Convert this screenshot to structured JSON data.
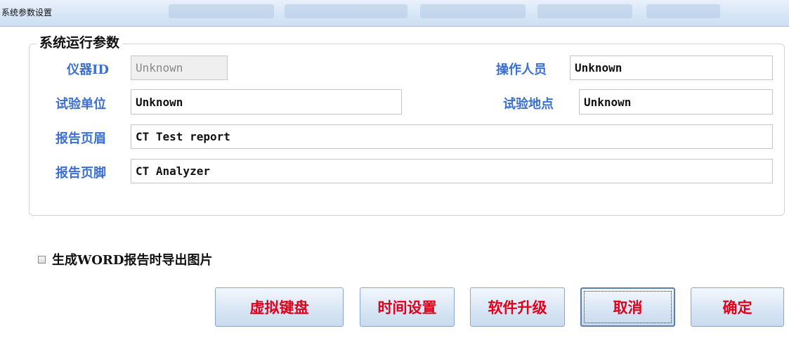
{
  "window": {
    "title": "系统参数设置"
  },
  "group": {
    "legend": "系统运行参数"
  },
  "fields": {
    "instrument_id": {
      "label": "仪器ID",
      "value": "Unknown"
    },
    "operator": {
      "label": "操作人员",
      "value": "Unknown"
    },
    "test_unit": {
      "label": "试验单位",
      "value": "Unknown"
    },
    "test_location": {
      "label": "试验地点",
      "value": "Unknown"
    },
    "report_header": {
      "label": "报告页眉",
      "value": "CT Test report"
    },
    "report_footer": {
      "label": "报告页脚",
      "value": "CT Analyzer"
    }
  },
  "export_images": {
    "label": "生成WORD报告时导出图片",
    "checked": false
  },
  "buttons": {
    "virtual_keyboard": "虚拟键盘",
    "time_settings": "时间设置",
    "software_upgrade": "软件升级",
    "cancel": "取消",
    "ok": "确定"
  },
  "colors": {
    "label_blue": "#3b6fd1",
    "button_red": "#e0001b"
  }
}
